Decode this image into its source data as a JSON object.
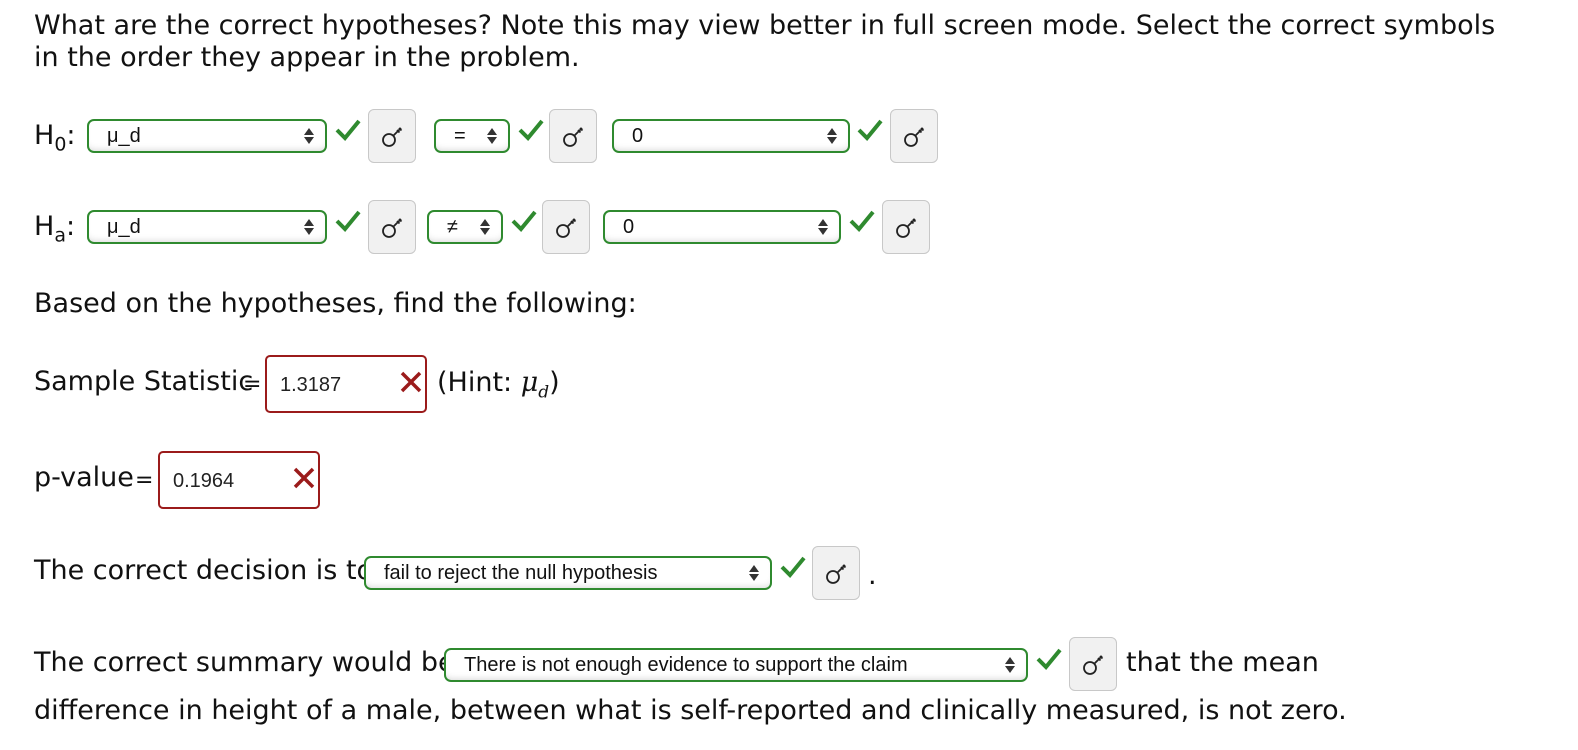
{
  "question": "What are the correct hypotheses? Note this may view better in full screen mode. Select the correct symbols in the order they appear in the problem.",
  "h0": {
    "label_main": "H",
    "label_sub": "0",
    "colon": ":",
    "param": "μ_d",
    "relation": "=",
    "value": "0"
  },
  "ha": {
    "label_main": "H",
    "label_sub": "a",
    "colon": ":",
    "param": "μ_d",
    "relation": "≠",
    "value": "0"
  },
  "based_on": "Based on the hypotheses, find the following:",
  "sample_statistic": {
    "label": "Sample Statistic",
    "equals": "=",
    "value": "1.3187",
    "hint_prefix": "(Hint: ",
    "hint_symbol": "μ",
    "hint_sub": "d",
    "hint_suffix": ")"
  },
  "p_value": {
    "label": "p-value",
    "equals": "=",
    "value": "0.1964"
  },
  "decision": {
    "prefix": "The correct decision is to",
    "selected": "fail to reject the null hypothesis",
    "suffix": "."
  },
  "summary": {
    "prefix": "The correct summary would be:",
    "selected": "There is not enough evidence to support the claim",
    "after": "that the mean",
    "line2": "difference in height of a male, between what is self-reported and clinically measured, is not zero."
  },
  "colors": {
    "correct_green": "#2f8a2f",
    "incorrect_red": "#9b1b1b"
  },
  "icons": {
    "correct": "checkmark-icon",
    "incorrect": "x-mark-icon",
    "answer": "key-icon"
  }
}
